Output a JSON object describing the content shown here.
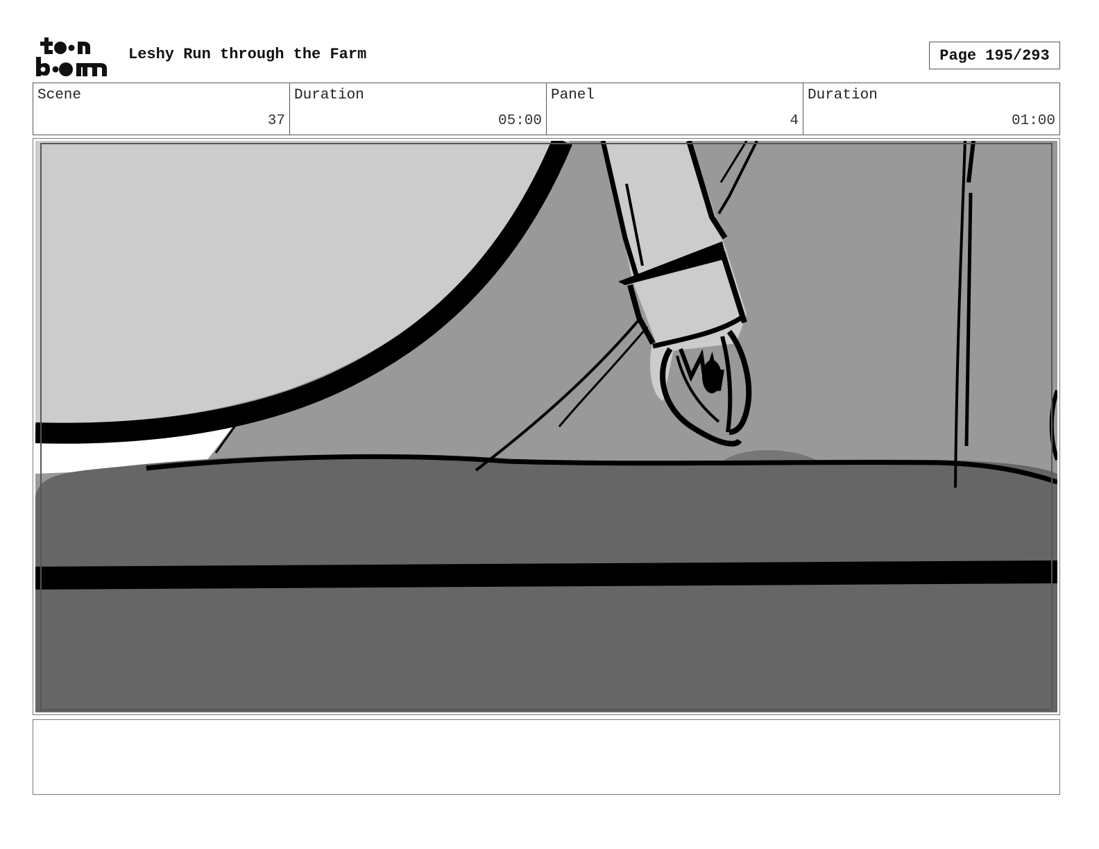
{
  "header": {
    "logo_text": "toonboom",
    "project_title": "Leshy Run through the Farm",
    "page_label": "Page 195/293"
  },
  "info": {
    "scene_label": "Scene",
    "scene_value": "37",
    "scene_duration_label": "Duration",
    "scene_duration_value": "05:00",
    "panel_label": "Panel",
    "panel_value": "4",
    "panel_duration_label": "Duration",
    "panel_duration_value": "01:00"
  },
  "notes": {
    "text": ""
  },
  "colors": {
    "light_gray": "#cccccc",
    "mid_gray": "#999999",
    "dark_gray": "#666666",
    "ink": "#000000",
    "border": "#555555"
  },
  "icons": [
    "toonboom-logo"
  ]
}
